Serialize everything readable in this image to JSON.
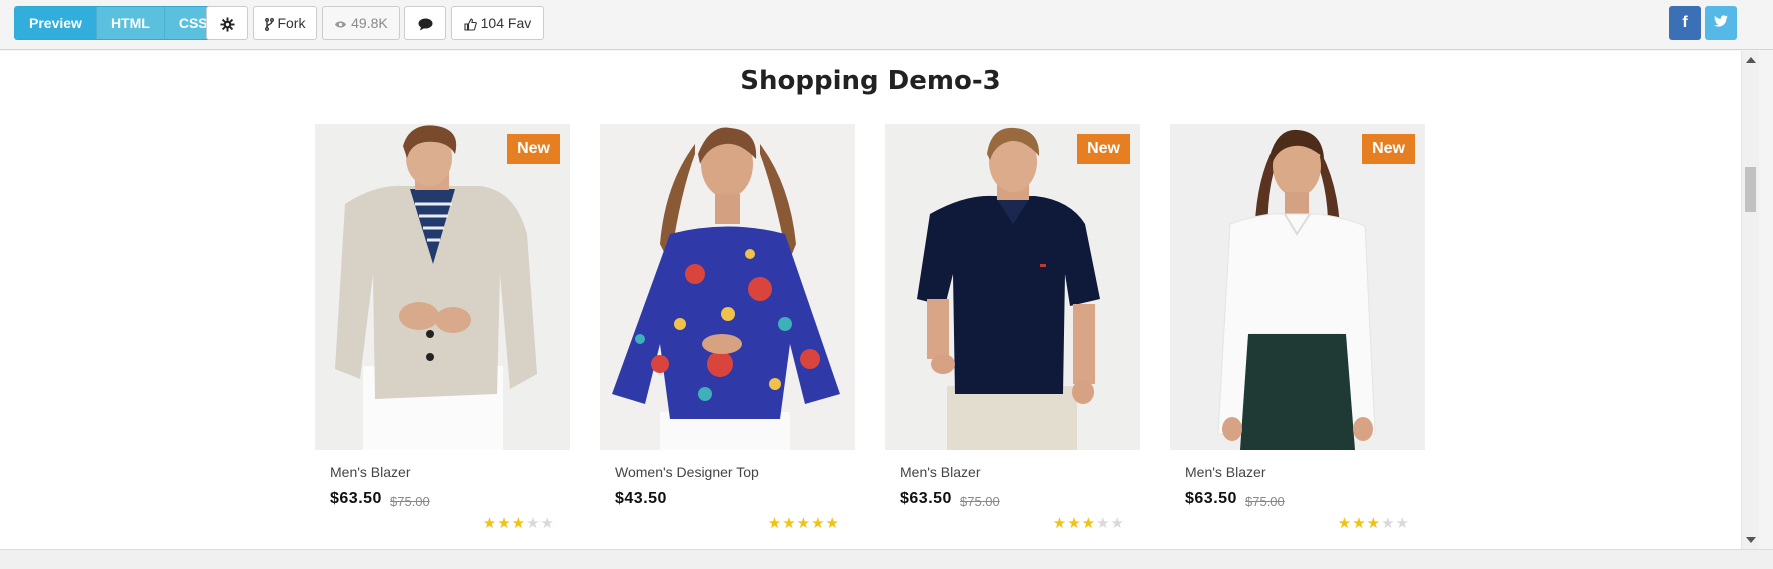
{
  "toolbar": {
    "tabs": [
      {
        "label": "Preview",
        "active": true
      },
      {
        "label": "HTML",
        "active": false
      },
      {
        "label": "CSS",
        "active": false
      }
    ],
    "settings_icon": "gear-icon",
    "fork_label": "Fork",
    "views_label": "49.8K",
    "comment_icon": "comment-icon",
    "fav_label": "104 Fav",
    "social": [
      {
        "label": "f",
        "icon": "facebook-icon"
      },
      {
        "label": "t",
        "icon": "twitter-icon"
      }
    ]
  },
  "page": {
    "title": "Shopping Demo-3"
  },
  "products": [
    {
      "name": "Men's Blazer",
      "price": "$63.50",
      "old_price": "$75.00",
      "badge": "New",
      "rating": 3
    },
    {
      "name": "Women's Designer Top",
      "price": "$43.50",
      "old_price": "",
      "badge": "",
      "rating": 5
    },
    {
      "name": "Men's Blazer",
      "price": "$63.50",
      "old_price": "$75.00",
      "badge": "New",
      "rating": 3
    },
    {
      "name": "Men's Blazer",
      "price": "$63.50",
      "old_price": "$75.00",
      "badge": "New",
      "rating": 3
    }
  ],
  "colors": {
    "accent": "#31aedb",
    "badge": "#e67e22",
    "star": "#f4c20d"
  }
}
